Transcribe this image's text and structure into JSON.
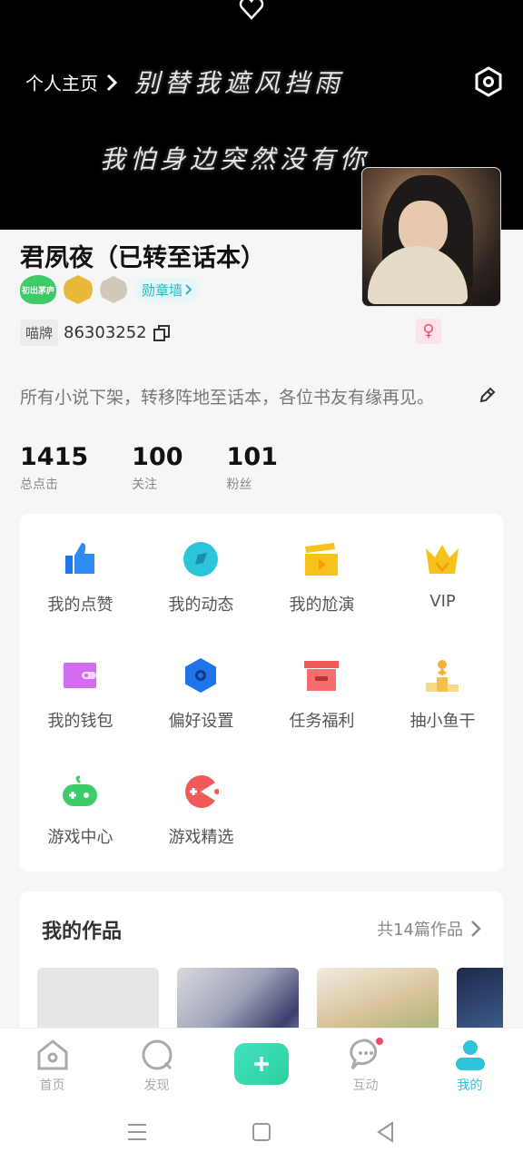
{
  "header": {
    "back_label": "个人主页",
    "lyric_line1": "别替我遮风挡雨",
    "lyric_line2": "我怕身边突然没有你"
  },
  "profile": {
    "name": "君夙夜（已转至话本）",
    "badges": [
      "初出茅庐"
    ],
    "medal_wall_label": "勋章墙",
    "id_tag": "喵牌",
    "id_number": "86303252",
    "gender_symbol": "♀",
    "bio": "所有小说下架，转移阵地至话本，各位书友有缘再见。"
  },
  "stats": [
    {
      "value": "1415",
      "label": "总点击"
    },
    {
      "value": "100",
      "label": "关注"
    },
    {
      "value": "101",
      "label": "粉丝"
    }
  ],
  "menu": [
    {
      "label": "我的点赞",
      "icon": "thumbs-up-icon"
    },
    {
      "label": "我的动态",
      "icon": "compass-icon"
    },
    {
      "label": "我的尬演",
      "icon": "clapperboard-icon"
    },
    {
      "label": "VIP",
      "icon": "crown-icon"
    },
    {
      "label": "我的钱包",
      "icon": "wallet-icon"
    },
    {
      "label": "偏好设置",
      "icon": "hexagon-settings-icon"
    },
    {
      "label": "任务福利",
      "icon": "gift-box-icon"
    },
    {
      "label": "抽小鱼干",
      "icon": "podium-icon"
    },
    {
      "label": "游戏中心",
      "icon": "gamepad-icon"
    },
    {
      "label": "游戏精选",
      "icon": "pacman-icon"
    }
  ],
  "works": {
    "title": "我的作品",
    "count_label": "共14篇作品"
  },
  "tabbar": [
    {
      "label": "首页",
      "icon": "home-icon"
    },
    {
      "label": "发现",
      "icon": "discover-icon"
    },
    {
      "label": "",
      "icon": "plus-icon"
    },
    {
      "label": "互动",
      "icon": "chat-icon"
    },
    {
      "label": "我的",
      "icon": "profile-icon"
    }
  ],
  "colors": {
    "accent": "#2bc4d8",
    "fab": "#33d6a8",
    "background": "#f6f6f7"
  }
}
